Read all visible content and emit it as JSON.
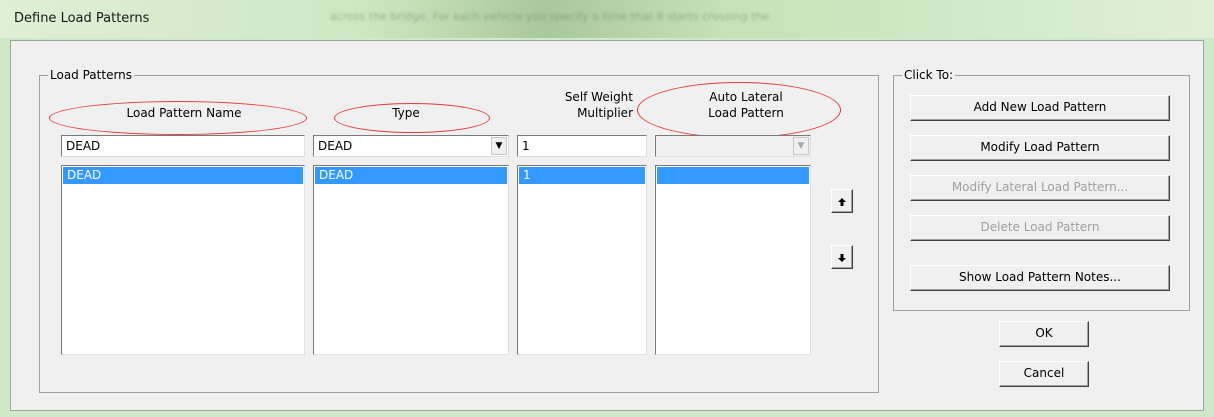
{
  "window": {
    "title": "Define Load Patterns",
    "background_text": "across the bridge. For each vehicle you specify a time that it starts crossing the"
  },
  "load_patterns": {
    "group_label": "Load Patterns",
    "headers": {
      "name": "Load Pattern Name",
      "type": "Type",
      "self_weight": [
        "Self Weight",
        "Multiplier"
      ],
      "auto_lateral": [
        "Auto Lateral",
        "Load Pattern"
      ]
    },
    "inputs": {
      "name_value": "DEAD",
      "type_value": "DEAD",
      "self_weight_value": "1",
      "auto_lateral_value": ""
    },
    "rows": [
      {
        "name": "DEAD",
        "type": "DEAD",
        "self_weight": "1",
        "auto_lateral": ""
      }
    ],
    "move_up_icon": "arrow-up-icon",
    "move_down_icon": "arrow-down-icon"
  },
  "click_to": {
    "group_label": "Click To:",
    "buttons": {
      "add": "Add New Load Pattern",
      "modify": "Modify Load Pattern",
      "modify_lateral": "Modify Lateral Load Pattern...",
      "delete": "Delete Load Pattern",
      "notes": "Show Load Pattern Notes..."
    }
  },
  "dialog_buttons": {
    "ok": "OK",
    "cancel": "Cancel"
  },
  "colors": {
    "selection": "#3399ff",
    "annotation": "#e33b3b"
  }
}
